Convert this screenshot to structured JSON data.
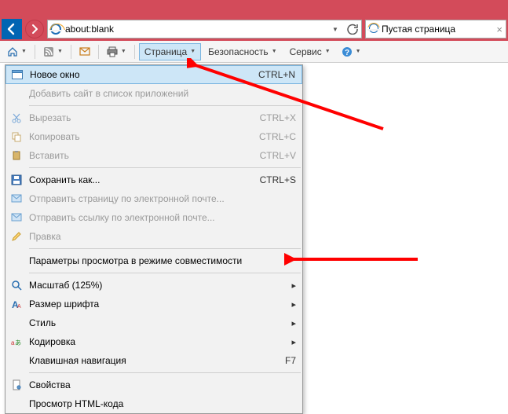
{
  "titlebar": {
    "dummy": ""
  },
  "nav": {
    "address": "about:blank",
    "tab_title": "Пустая страница"
  },
  "toolbar": {
    "page": "Страница",
    "security": "Безопасность",
    "service": "Сервис"
  },
  "menu": {
    "new_window": "Новое окно",
    "new_window_key": "CTRL+N",
    "add_to_apps": "Добавить сайт в список приложений",
    "cut": "Вырезать",
    "cut_key": "CTRL+X",
    "copy": "Копировать",
    "copy_key": "CTRL+C",
    "paste": "Вставить",
    "paste_key": "CTRL+V",
    "save_as": "Сохранить как...",
    "save_as_key": "CTRL+S",
    "send_page": "Отправить страницу по электронной почте...",
    "send_link": "Отправить ссылку по электронной почте...",
    "edit": "Правка",
    "compat": "Параметры просмотра в режиме совместимости",
    "zoom": "Масштаб (125%)",
    "font_size": "Размер шрифта",
    "style": "Стиль",
    "encoding": "Кодировка",
    "keyboard_nav": "Клавишная навигация",
    "keyboard_nav_key": "F7",
    "properties": "Свойства",
    "view_source": "Просмотр HTML-кода"
  }
}
